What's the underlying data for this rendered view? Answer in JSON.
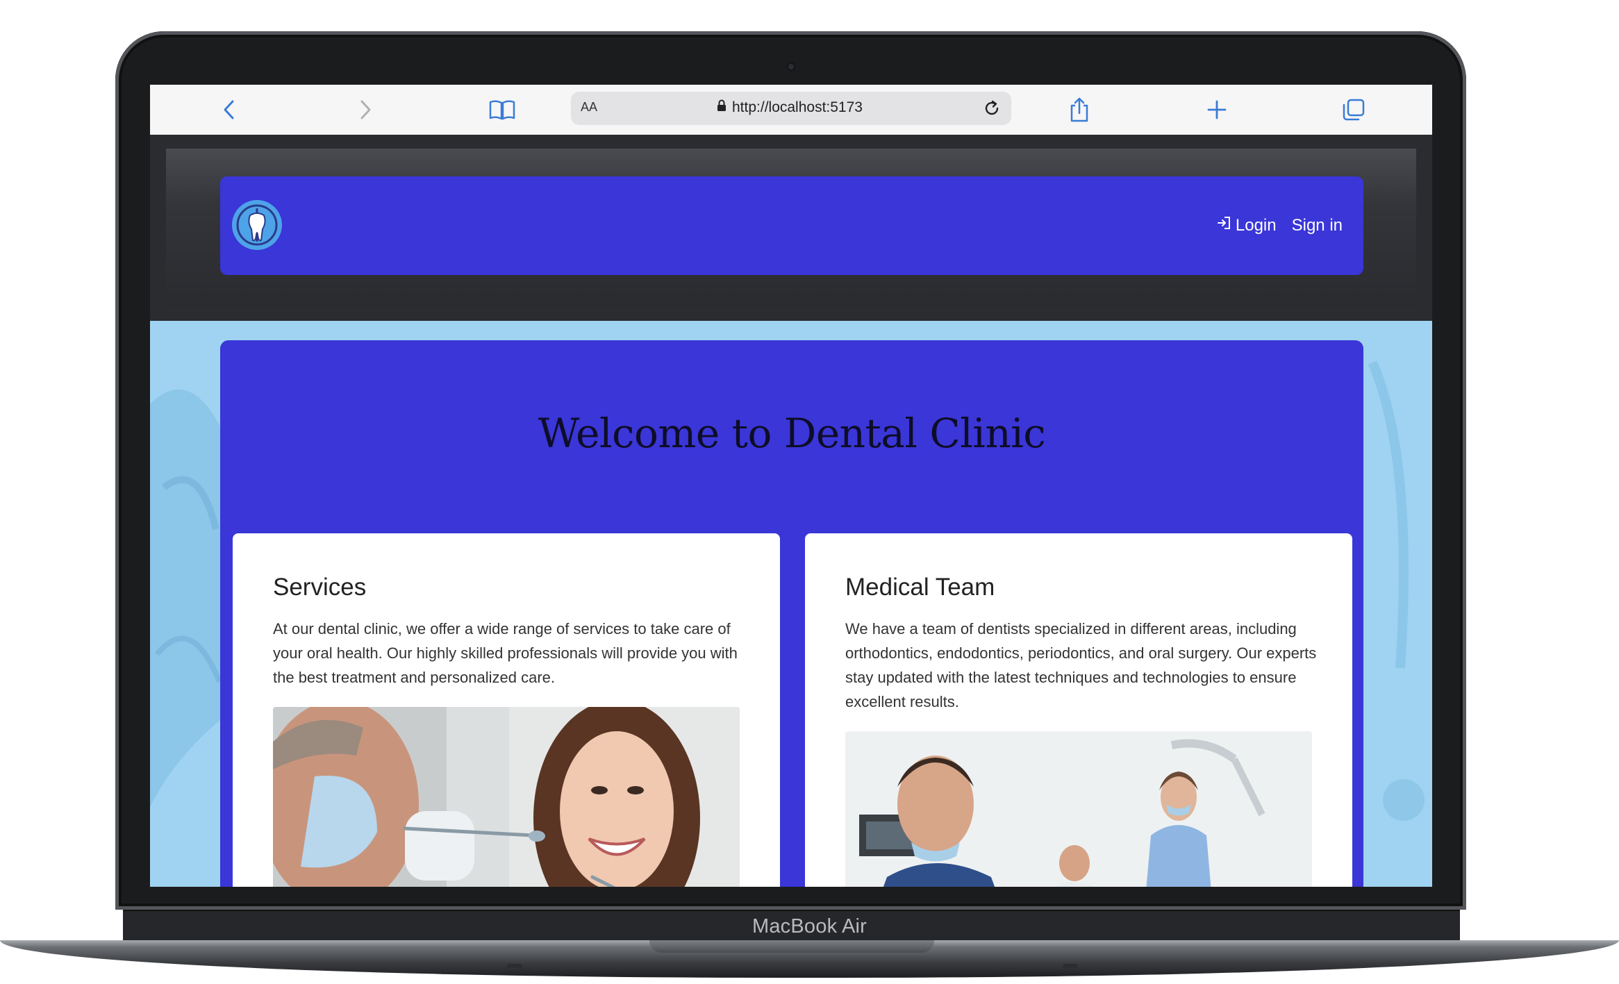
{
  "device": {
    "label": "MacBook Air"
  },
  "browser": {
    "text_size_label": "AA",
    "url": "http://localhost:5173",
    "icons": [
      "back-icon",
      "forward-icon",
      "bookmarks-icon",
      "lock-icon",
      "reload-icon",
      "share-icon",
      "new-tab-icon",
      "tabs-icon"
    ]
  },
  "nav": {
    "login_label": "Login",
    "signin_label": "Sign in"
  },
  "hero": {
    "title": "Welcome to Dental Clinic"
  },
  "cards": [
    {
      "title": "Services",
      "text": "At our dental clinic, we offer a wide range of services to take care of your oral health. Our highly skilled professionals will provide you with the best treatment and personalized care."
    },
    {
      "title": "Medical Team",
      "text": "We have a team of dentists specialized in different areas, including orthodontics, endodontics, periodontics, and oral surgery. Our experts stay updated with the latest techniques and technologies to ensure excellent results."
    }
  ],
  "colors": {
    "brand": "#3a36d8",
    "page_background": "#9fd3f1",
    "header_background": "#2b2c30",
    "logo": "#4ea3e8"
  }
}
